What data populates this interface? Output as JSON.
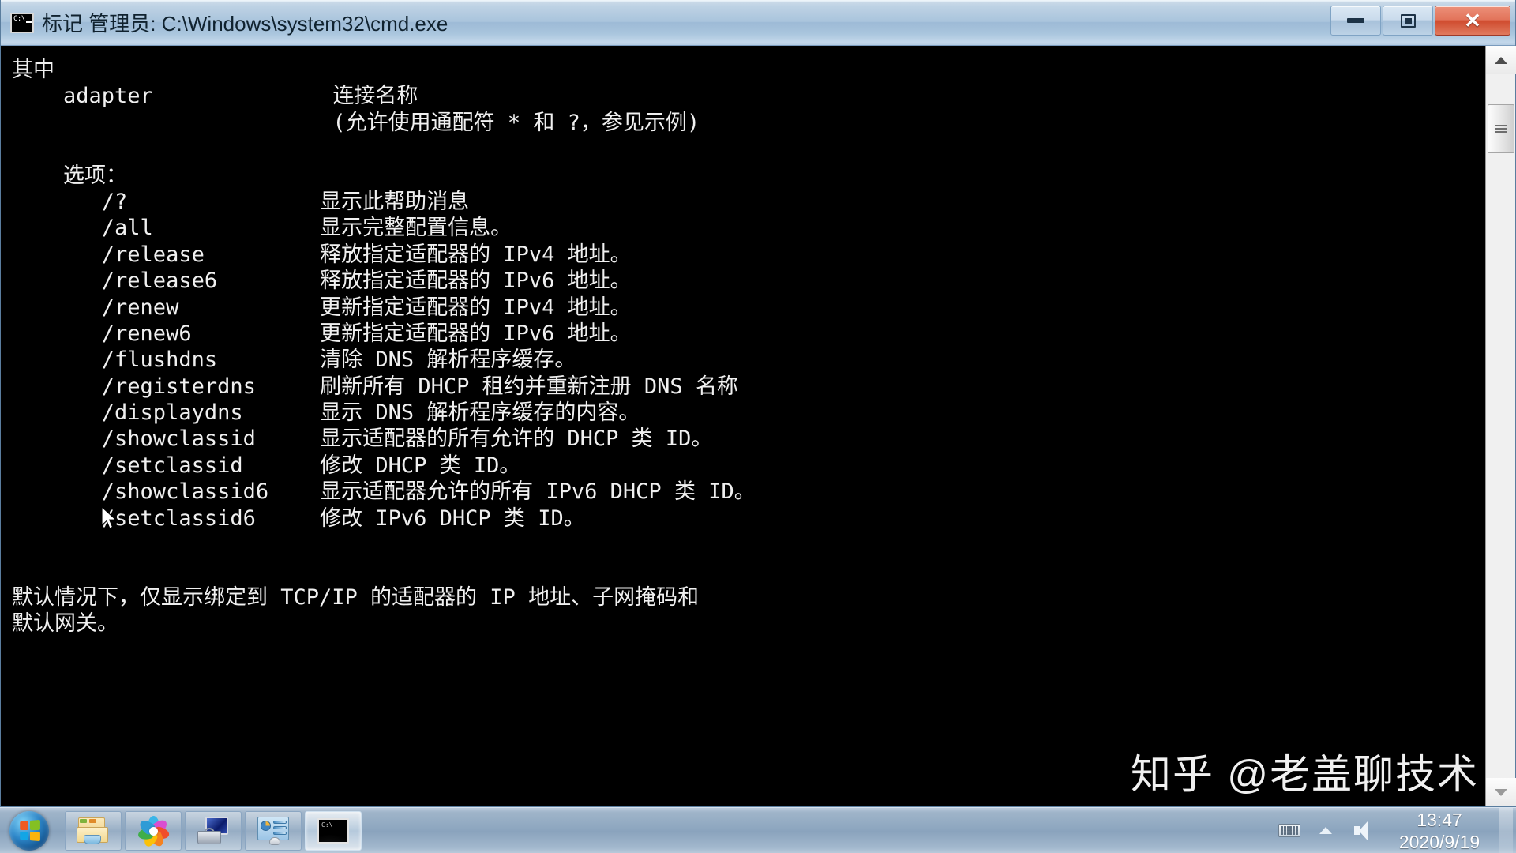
{
  "window": {
    "title": "标记 管理员: C:\\Windows\\system32\\cmd.exe",
    "icon_name": "cmd-icon",
    "buttons": {
      "minimize_label": "–",
      "maximize_label": "□",
      "close_label": "✕"
    }
  },
  "console": {
    "lines": [
      "其中",
      "    adapter              连接名称",
      "                         (允许使用通配符 * 和 ?，参见示例)",
      "",
      "    选项：",
      "       /?               显示此帮助消息",
      "       /all             显示完整配置信息。",
      "       /release         释放指定适配器的 IPv4 地址。",
      "       /release6        释放指定适配器的 IPv6 地址。",
      "       /renew           更新指定适配器的 IPv4 地址。",
      "       /renew6          更新指定适配器的 IPv6 地址。",
      "       /flushdns        清除 DNS 解析程序缓存。",
      "       /registerdns     刷新所有 DHCP 租约并重新注册 DNS 名称",
      "       /displaydns      显示 DNS 解析程序缓存的内容。",
      "       /showclassid     显示适配器的所有允许的 DHCP 类 ID。",
      "       /setclassid      修改 DHCP 类 ID。",
      "       /showclassid6    显示适配器允许的所有 IPv6 DHCP 类 ID。",
      "       /setclassid6     修改 IPv6 DHCP 类 ID。",
      "",
      "",
      "默认情况下，仅显示绑定到 TCP/IP 的适配器的 IP 地址、子网掩码和",
      "默认网关。"
    ],
    "text_color": "#f0f0f0",
    "background_color": "#000000"
  },
  "scrollbar": {
    "up_arrow_name": "scroll-up-arrow",
    "down_arrow_name": "scroll-down-arrow",
    "thumb_name": "scroll-thumb"
  },
  "watermark": {
    "text": "知乎 @老盖聊技术"
  },
  "taskbar": {
    "start_name": "start-orb",
    "items": [
      {
        "name": "taskbar-explorer",
        "icon": "folder-icon",
        "active": false
      },
      {
        "name": "taskbar-browser",
        "icon": "pinwheel-icon",
        "active": false
      },
      {
        "name": "taskbar-computer",
        "icon": "computer-toolbox-icon",
        "active": false
      },
      {
        "name": "taskbar-control-panel",
        "icon": "control-panel-icon",
        "active": false
      },
      {
        "name": "taskbar-cmd",
        "icon": "cmd-icon",
        "active": true
      }
    ],
    "tray": {
      "keyboard_icon": "keyboard-ime-icon",
      "show_hidden_icon": "show-hidden-icons-arrow",
      "volume_icon": "volume-icon",
      "time": "13:47",
      "date": "2020/9/19"
    }
  }
}
